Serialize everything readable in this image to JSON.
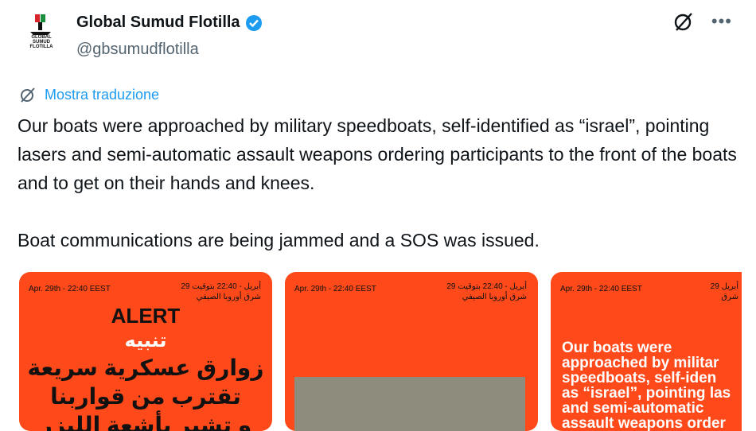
{
  "author": {
    "name": "Global Sumud Flotilla",
    "handle": "@gbsumudflotilla",
    "avatar_text": "GLOBAL SUMUD FLOTILLA"
  },
  "translate": {
    "label": "Mostra traduzione"
  },
  "tweet": {
    "p1": "Our boats were approached by military speedboats, self-identified as “israel”, pointing lasers and semi-automatic assault weapons ordering participants to the front of the boats and to get on their hands and knees.",
    "p2": "Boat communications are being jammed and a SOS was issued."
  },
  "cards": [
    {
      "meta_left": "Apr. 29th - 22:40 EEST",
      "meta_right_1": "29 أبريل - 22:40 بتوقيت",
      "meta_right_2": "شرق أوروبا الصيفي",
      "alert": "ALERT",
      "alert_ar": "تنبيه",
      "ar_lines": [
        "زوارق عسكرية سريعة",
        "تقترب من قواربنا",
        "و تشير بأشعة الليزر"
      ]
    },
    {
      "meta_left": "Apr. 29th - 22:40 EEST",
      "meta_right_1": "29 أبريل - 22:40 بتوقيت",
      "meta_right_2": "شرق أوروبا الصيفي"
    },
    {
      "meta_left": "Apr. 29th - 22:40 EEST",
      "meta_right_1": "29 أبريل",
      "meta_right_2": "شرق",
      "text_lines": [
        "Our boats were",
        "approached by militar",
        "speedboats, self-iden",
        "as “israel”, pointing las",
        "and semi-automatic",
        "assault weapons order"
      ]
    }
  ],
  "colors": {
    "card_bg": "#fe4a1a",
    "link": "#1d9bf0",
    "verified": "#1d9bf0"
  },
  "icons": [
    "flotilla-logo",
    "verified-badge-icon",
    "grok-icon",
    "more-icon",
    "translate-icon"
  ]
}
